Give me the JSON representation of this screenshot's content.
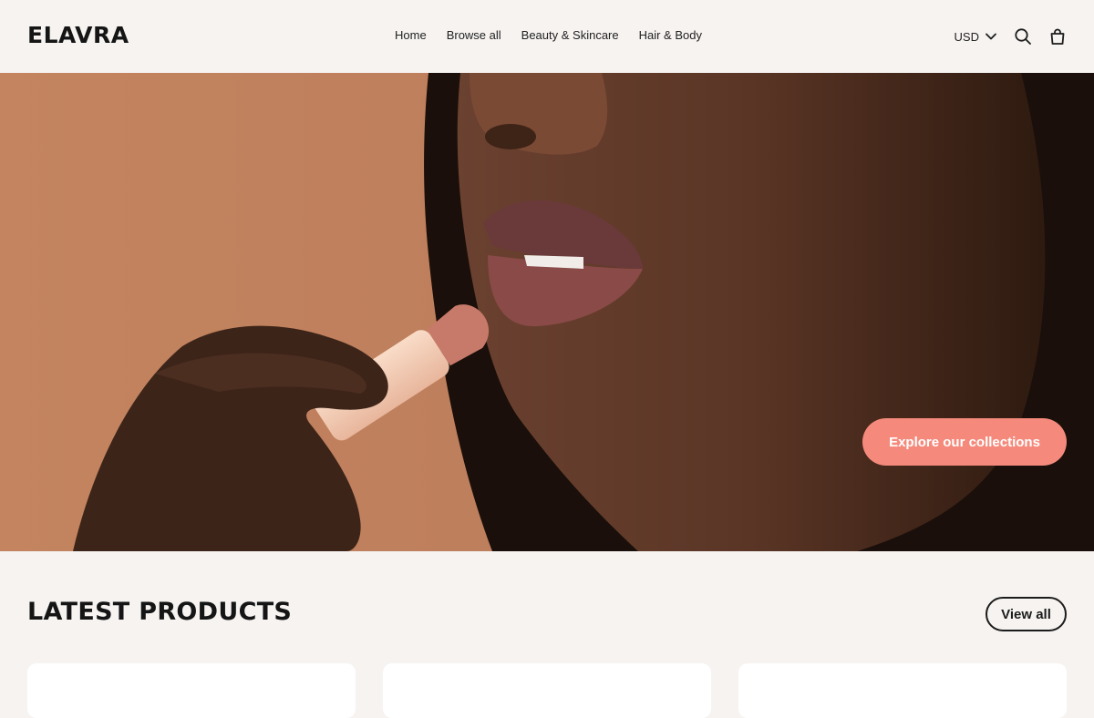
{
  "header": {
    "logo": "ELAVRA",
    "nav": [
      "Home",
      "Browse all",
      "Beauty & Skincare",
      "Hair & Body"
    ],
    "currency": "USD",
    "icons": [
      "chevron-down-icon",
      "search-icon",
      "shopping-bag-icon"
    ]
  },
  "hero": {
    "cta_label": "Explore our collections",
    "cta_color": "#f58a7c"
  },
  "products": {
    "title": "LATEST PRODUCTS",
    "view_all_label": "View all"
  }
}
